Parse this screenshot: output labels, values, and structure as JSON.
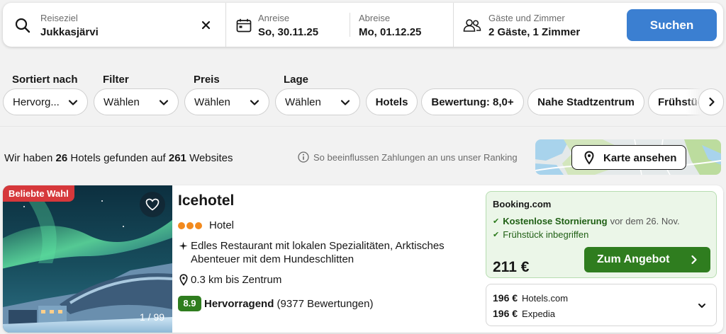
{
  "search": {
    "destination_label": "Reiseziel",
    "destination_value": "Jukkasjärvi",
    "checkin_label": "Anreise",
    "checkin_value": "So, 30.11.25",
    "checkout_label": "Abreise",
    "checkout_value": "Mo, 01.12.25",
    "guests_label": "Gäste und Zimmer",
    "guests_value": "2 Gäste, 1 Zimmer",
    "search_button": "Suchen"
  },
  "filters": {
    "sort_label": "Sortiert nach",
    "sort_value": "Hervorg...",
    "filter_label": "Filter",
    "filter_value": "Wählen",
    "price_label": "Preis",
    "price_value": "Wählen",
    "location_label": "Lage",
    "location_value": "Wählen",
    "chips": [
      "Hotels",
      "Bewertung: 8,0+",
      "Nahe Stadtzentrum",
      "Frühstück"
    ]
  },
  "results": {
    "prefix": "Wir haben",
    "hotel_count": "26",
    "middle": "Hotels gefunden auf",
    "site_count": "261",
    "suffix": "Websites",
    "ranking_note": "So beeinflussen Zahlungen an uns unser Ranking",
    "map_button": "Karte ansehen"
  },
  "hotel": {
    "badge": "Beliebte Wahl",
    "photo_counter": "1 / 99",
    "name": "Icehotel",
    "stars": 3,
    "type": "Hotel",
    "feature": "Edles Restaurant mit lokalen Spezialitäten, Arktisches Abenteuer mit dem Hundeschlitten",
    "distance": "0.3 km bis Zentrum",
    "rating_score": "8.9",
    "rating_word": "Hervorragend",
    "rating_count": "(9377 Bewertungen)",
    "deal": {
      "site": "Booking.com",
      "perk1_bold": "Kostenlose Stornierung",
      "perk1_rest": "vor dem 26. Nov.",
      "perk2": "Frühstück inbegriffen",
      "price": "211 €",
      "button": "Zum Angebot"
    },
    "other_offers": [
      {
        "price": "196 €",
        "site": "Hotels.com"
      },
      {
        "price": "196 €",
        "site": "Expedia"
      }
    ]
  },
  "colors": {
    "primary": "#3b7fd1",
    "deal_green": "#2f7d1f",
    "badge_red": "#d6383b",
    "star_orange": "#f28a1e"
  }
}
